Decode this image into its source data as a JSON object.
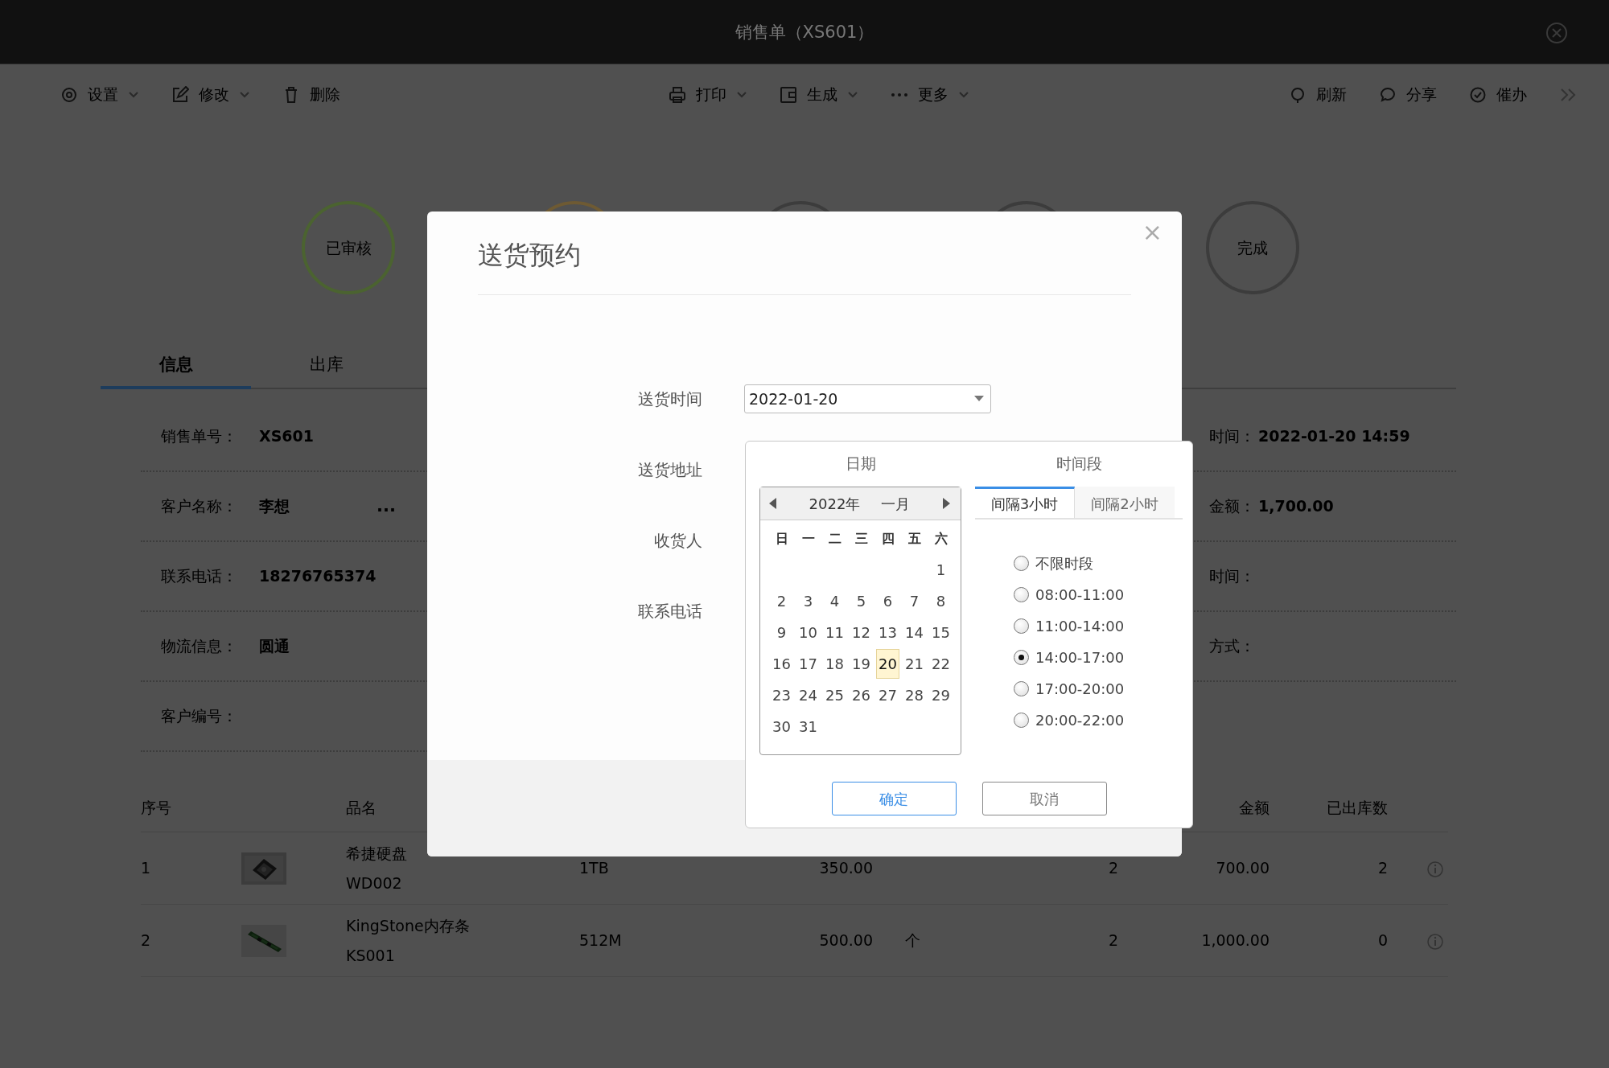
{
  "window": {
    "title": "销售单（XS601）"
  },
  "toolbar": {
    "left": [
      {
        "label": "设置",
        "dropdown": true
      },
      {
        "label": "修改",
        "dropdown": true
      },
      {
        "label": "删除",
        "dropdown": false
      }
    ],
    "center": [
      {
        "label": "打印",
        "dropdown": true
      },
      {
        "label": "生成",
        "dropdown": true
      },
      {
        "label": "更多",
        "dropdown": true
      }
    ],
    "right": [
      {
        "label": "刷新",
        "dropdown": false
      },
      {
        "label": "分享",
        "dropdown": false
      },
      {
        "label": "催办",
        "dropdown": false
      }
    ]
  },
  "steps": [
    {
      "label": "已审核",
      "color": "#4b6330"
    },
    {
      "color": "#6e5a33"
    },
    {
      "color": "#3c3c3c"
    },
    {
      "color": "#3c3c3c"
    },
    {
      "label": "完成",
      "color": "#3c3c3c"
    }
  ],
  "tabs": [
    {
      "label": "信息",
      "selected": true
    },
    {
      "label": "出库",
      "selected": false
    }
  ],
  "info": {
    "left": [
      {
        "label": "销售单号：",
        "value": "XS601"
      },
      {
        "label": "客户名称：",
        "value": "李想",
        "extra": "..."
      },
      {
        "label": "联系电话：",
        "value": "18276765374"
      },
      {
        "label": "物流信息：",
        "value": "圆通"
      },
      {
        "label": "客户编号："
      }
    ],
    "right": [
      {
        "label": "时间：",
        "value": "2022-01-20 14:59"
      },
      {
        "label": "金额：",
        "value": "1,700.00"
      },
      {
        "label": "时间："
      },
      {
        "label": "方式："
      }
    ]
  },
  "table": {
    "columns": [
      "序号",
      "品名",
      "金额",
      "已出库数"
    ],
    "rows": [
      {
        "no": "1",
        "name": "希捷硬盘",
        "code": "WD002",
        "spec": "1TB",
        "price": "350.00",
        "qty": "2",
        "amount": "700.00",
        "shipped": "2"
      },
      {
        "no": "2",
        "name": "KingStone内存条",
        "code": "KS001",
        "spec": "512M",
        "price": "500.00",
        "unit": "个",
        "qty": "2",
        "amount": "1,000.00",
        "shipped": "0"
      }
    ]
  },
  "dialog": {
    "title": "送货预约",
    "close": "×",
    "fields": [
      {
        "label": "送货时间",
        "value": "2022-01-20"
      },
      {
        "label": "送货地址"
      },
      {
        "label": "收货人"
      },
      {
        "label": "联系电话"
      }
    ],
    "picker": {
      "date_heading": "日期",
      "time_heading": "时间段",
      "year": "2022年",
      "month": "一月",
      "weekdays": [
        "日",
        "一",
        "二",
        "三",
        "四",
        "五",
        "六"
      ],
      "weeks": [
        [
          {
            "day": "1",
            "selected": false
          }
        ],
        [
          {
            "day": "2",
            "selected": false
          },
          {
            "day": "3",
            "selected": false
          },
          {
            "day": "4",
            "selected": false
          },
          {
            "day": "5",
            "selected": false
          },
          {
            "day": "6",
            "selected": false
          },
          {
            "day": "7",
            "selected": false
          },
          {
            "day": "8",
            "selected": false
          }
        ],
        [
          {
            "day": "9",
            "selected": false
          },
          {
            "day": "10",
            "selected": false
          },
          {
            "day": "11",
            "selected": false
          },
          {
            "day": "12",
            "selected": false
          },
          {
            "day": "13",
            "selected": false
          },
          {
            "day": "14",
            "selected": false
          },
          {
            "day": "15",
            "selected": false
          }
        ],
        [
          {
            "day": "16",
            "selected": false
          },
          {
            "day": "17",
            "selected": false
          },
          {
            "day": "18",
            "selected": false
          },
          {
            "day": "19",
            "selected": false
          },
          {
            "day": "20",
            "selected": true
          },
          {
            "day": "21",
            "selected": false
          },
          {
            "day": "22",
            "selected": false
          }
        ],
        [
          {
            "day": "23",
            "selected": false
          },
          {
            "day": "24",
            "selected": false
          },
          {
            "day": "25",
            "selected": false
          },
          {
            "day": "26",
            "selected": false
          },
          {
            "day": "27",
            "selected": false
          },
          {
            "day": "28",
            "selected": false
          },
          {
            "day": "29",
            "selected": false
          }
        ],
        [
          {
            "day": "30",
            "selected": false
          },
          {
            "day": "31",
            "selected": false
          }
        ]
      ],
      "time_tabs": [
        {
          "label": "间隔3小时",
          "selected": true
        },
        {
          "label": "间隔2小时",
          "selected": false
        }
      ],
      "slots": [
        {
          "label": "不限时段",
          "selected": false
        },
        {
          "label": "08:00-11:00",
          "selected": false
        },
        {
          "label": "11:00-14:00",
          "selected": false
        },
        {
          "label": "14:00-17:00",
          "selected": true
        },
        {
          "label": "17:00-20:00",
          "selected": false
        },
        {
          "label": "20:00-22:00",
          "selected": false
        }
      ],
      "buttons": [
        {
          "label": "确定",
          "kind": "primary"
        },
        {
          "label": "取消",
          "kind": "secondary"
        }
      ]
    }
  }
}
